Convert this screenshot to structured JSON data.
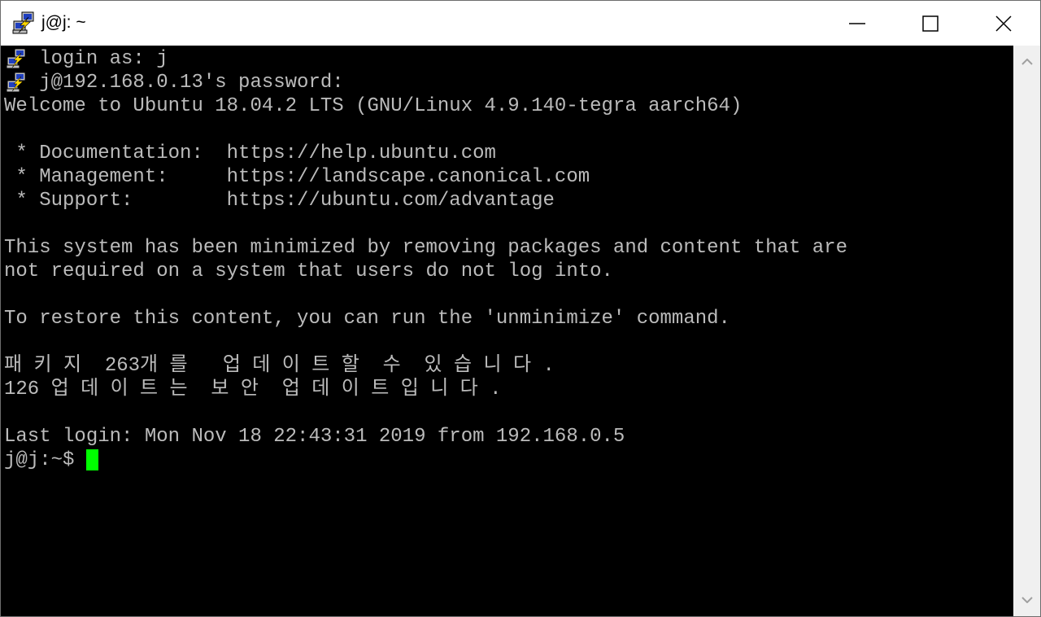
{
  "window": {
    "title": "j@j: ~",
    "controls": {
      "minimize": "minimize",
      "maximize": "maximize",
      "close": "close"
    }
  },
  "terminal": {
    "lines": [
      {
        "text": "   login as: j",
        "icon": "putty-icon"
      },
      {
        "text": "   j@192.168.0.13's password:",
        "icon": "putty-icon"
      },
      {
        "text": "Welcome to Ubuntu 18.04.2 LTS (GNU/Linux 4.9.140-tegra aarch64)"
      },
      {
        "text": ""
      },
      {
        "text": " * Documentation:  https://help.ubuntu.com"
      },
      {
        "text": " * Management:     https://landscape.canonical.com"
      },
      {
        "text": " * Support:        https://ubuntu.com/advantage"
      },
      {
        "text": ""
      },
      {
        "text": "This system has been minimized by removing packages and content that are"
      },
      {
        "text": "not required on a system that users do not log into."
      },
      {
        "text": ""
      },
      {
        "text": "To restore this content, you can run the 'unminimize' command."
      },
      {
        "text": ""
      },
      {
        "text": "패 키 지  263개 를   업 데 이 트 할  수  있 습 니 다 ."
      },
      {
        "text": "126 업 데 이 트 는  보 안  업 데 이 트 입 니 다 ."
      },
      {
        "text": ""
      },
      {
        "text": "Last login: Mon Nov 18 22:43:31 2019 from 192.168.0.5"
      }
    ],
    "prompt": "j@j:~$ ",
    "cursor_color": "#00ff00",
    "text_color": "#bbbbbb",
    "background_color": "#000000"
  }
}
